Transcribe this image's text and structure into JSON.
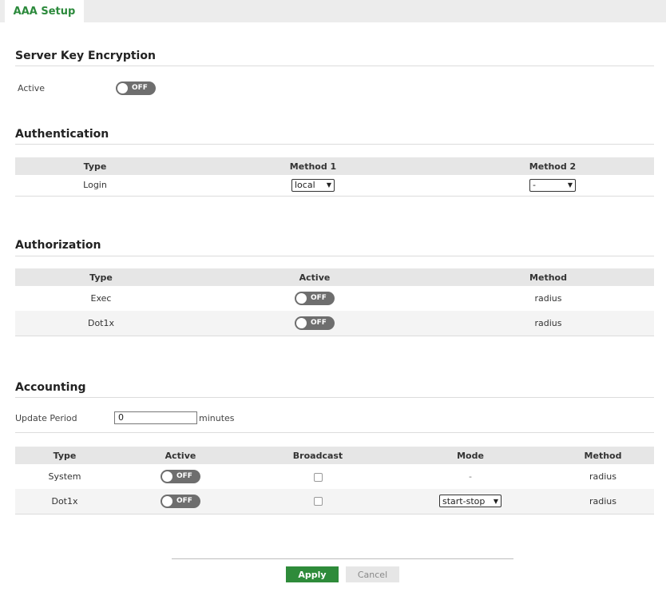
{
  "tabs": [
    {
      "label": "AAA Setup"
    }
  ],
  "server_key_encryption": {
    "title": "Server Key Encryption",
    "active_label": "Active",
    "active_state": "OFF"
  },
  "authentication": {
    "title": "Authentication",
    "headers": [
      "Type",
      "Method 1",
      "Method 2"
    ],
    "rows": [
      {
        "type": "Login",
        "method1": "local",
        "method2": "-"
      }
    ]
  },
  "authorization": {
    "title": "Authorization",
    "headers": [
      "Type",
      "Active",
      "Method"
    ],
    "rows": [
      {
        "type": "Exec",
        "active": "OFF",
        "method": "radius"
      },
      {
        "type": "Dot1x",
        "active": "OFF",
        "method": "radius"
      }
    ]
  },
  "accounting": {
    "title": "Accounting",
    "update_period_label": "Update Period",
    "update_period_value": "0",
    "update_period_unit": "minutes",
    "headers": [
      "Type",
      "Active",
      "Broadcast",
      "Mode",
      "Method"
    ],
    "rows": [
      {
        "type": "System",
        "active": "OFF",
        "broadcast": false,
        "mode": "-",
        "method": "radius"
      },
      {
        "type": "Dot1x",
        "active": "OFF",
        "broadcast": false,
        "mode": "start-stop",
        "method": "radius"
      }
    ]
  },
  "actions": {
    "apply_label": "Apply",
    "cancel_label": "Cancel"
  },
  "colors": {
    "accent": "#2e8b3a",
    "toggle_off": "#6e6e6e"
  }
}
